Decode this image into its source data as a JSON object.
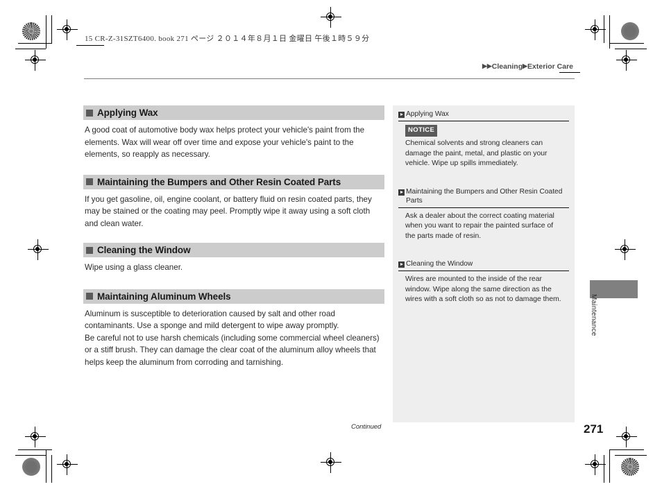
{
  "header": {
    "book_line": "15 CR-Z-31SZT6400. book   271 ページ   ２０１４年８月１日   金曜日   午後１時５９分",
    "breadcrumb_arrows": "▶▶",
    "breadcrumb_parent": "Cleaning",
    "breadcrumb_arrow2": "▶",
    "breadcrumb_current": "Exterior Care"
  },
  "main": {
    "sections": [
      {
        "title": "Applying Wax",
        "body": "A good coat of automotive body wax helps protect your vehicle's paint from the elements. Wax will wear off over time and expose your vehicle's paint to the elements, so reapply as necessary."
      },
      {
        "title": "Maintaining the Bumpers and Other Resin Coated Parts",
        "body": "If you get gasoline, oil, engine coolant, or battery fluid on resin coated parts, they may be stained or the coating may peel. Promptly wipe it away using a soft cloth and clean water."
      },
      {
        "title": "Cleaning the Window",
        "body": "Wipe using a glass cleaner."
      },
      {
        "title": "Maintaining Aluminum Wheels",
        "body_1": "Aluminum is susceptible to deterioration caused by salt and other road contaminants. Use a sponge and mild detergent to wipe away promptly.",
        "body_2": "Be careful not to use harsh chemicals (including some commercial wheel cleaners) or a stiff brush. They can damage the clear coat of the aluminum alloy wheels that helps keep the aluminum from corroding and tarnishing."
      }
    ]
  },
  "sidebar": {
    "blocks": [
      {
        "label": "Applying Wax",
        "notice_badge": "NOTICE",
        "body": "Chemical solvents and strong cleaners can damage the paint, metal, and plastic on your vehicle. Wipe up spills immediately."
      },
      {
        "label": "Maintaining the Bumpers and Other Resin Coated Parts",
        "body": "Ask a dealer about the correct coating material when you want to repair the painted surface of the parts made of resin."
      },
      {
        "label": "Cleaning the Window",
        "body": "Wires are mounted to the inside of the rear window. Wipe along the same direction as the wires with a soft cloth so as not to damage them."
      }
    ]
  },
  "footer": {
    "tab_label": "Maintenance",
    "continued": "Continued",
    "page_number": "271"
  },
  "colors": {
    "section_header_bg": "#cccccc",
    "section_bullet": "#5a5a5a",
    "sidebar_bg": "#eeeeee",
    "notice_bg": "#5a5a5a",
    "tab_block": "#808080"
  }
}
